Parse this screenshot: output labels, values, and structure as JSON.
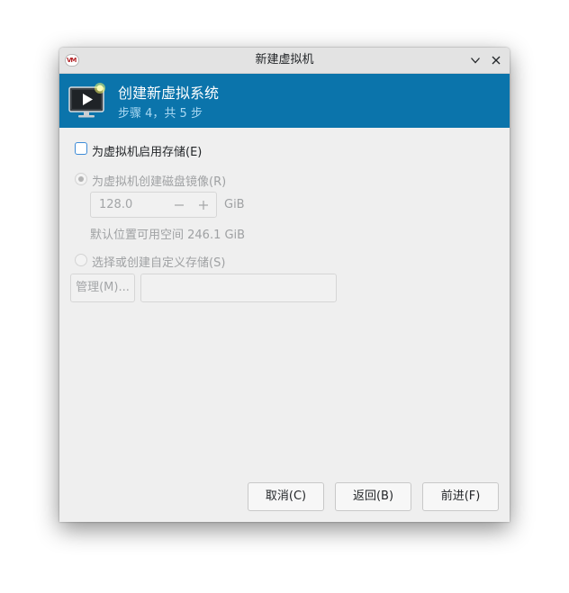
{
  "window": {
    "title": "新建虚拟机",
    "app_icon_text": "VM"
  },
  "banner": {
    "title": "创建新虚拟系统",
    "step": "步骤 4，共 5 步"
  },
  "storage": {
    "enable_label": "为虚拟机启用存储(E)",
    "enable_checked": false,
    "create_disk_label": "为虚拟机创建磁盘镜像(R)",
    "create_disk_selected": true,
    "size_value": "128.0",
    "size_unit": "GiB",
    "free_space": "默认位置可用空间 246.1 GiB",
    "custom_label": "选择或创建自定义存储(S)",
    "custom_selected": false,
    "manage_label": "管理(M)...",
    "path_value": ""
  },
  "footer": {
    "cancel_label": "取消(C)",
    "back_label": "返回(B)",
    "forward_label": "前进(F)"
  },
  "colors": {
    "banner_bg": "#0b74ab",
    "banner_subtitle": "#a9d8f2",
    "window_bg": "#efefef",
    "checkbox_border": "#3d8bd7",
    "disabled_text": "#9fa1a3"
  }
}
